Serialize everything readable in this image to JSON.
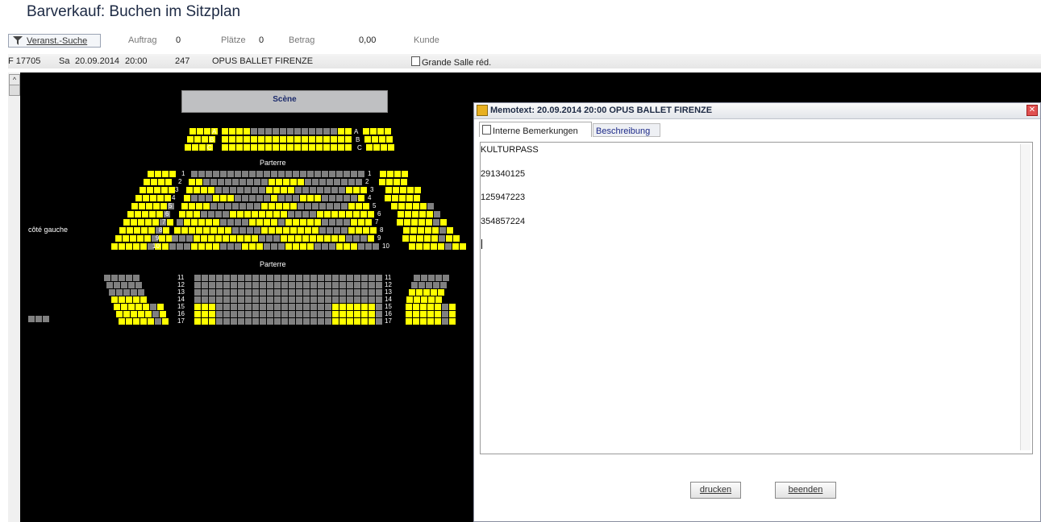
{
  "window_title": "Barverkauf: Buchen im Sitzplan",
  "toolbar": {
    "filter_button": "Veranst.-Suche",
    "auftrag_label": "Auftrag",
    "auftrag_value": "0",
    "plaetze_label": "Plätze",
    "plaetze_value": "0",
    "betrag_label": "Betrag",
    "betrag_value": "0,00",
    "kunde_label": "Kunde"
  },
  "event": {
    "code": "F 17705",
    "day": "Sa",
    "date": "20.09.2014",
    "time": "20:00",
    "number": "247",
    "name": "OPUS BALLET FIRENZE",
    "hall": "Grande Salle réd."
  },
  "seatmap": {
    "stage_label": "Scène",
    "section_upper": "Parterre",
    "section_lower": "Parterre",
    "side_left": "côté gauche",
    "colors": {
      "free": "#ffff00",
      "occupied": "#808080",
      "background": "#000000"
    }
  },
  "dialog": {
    "title": "Memotext: 20.09.2014 20:00 OPUS BALLET FIRENZE",
    "tabs": [
      "Interne Bemerkungen",
      "Beschreibung"
    ],
    "lines": [
      "KULTURPASS",
      "291340125",
      "125947223",
      "354857224"
    ],
    "print_button": "drucken",
    "close_button": "beenden"
  }
}
